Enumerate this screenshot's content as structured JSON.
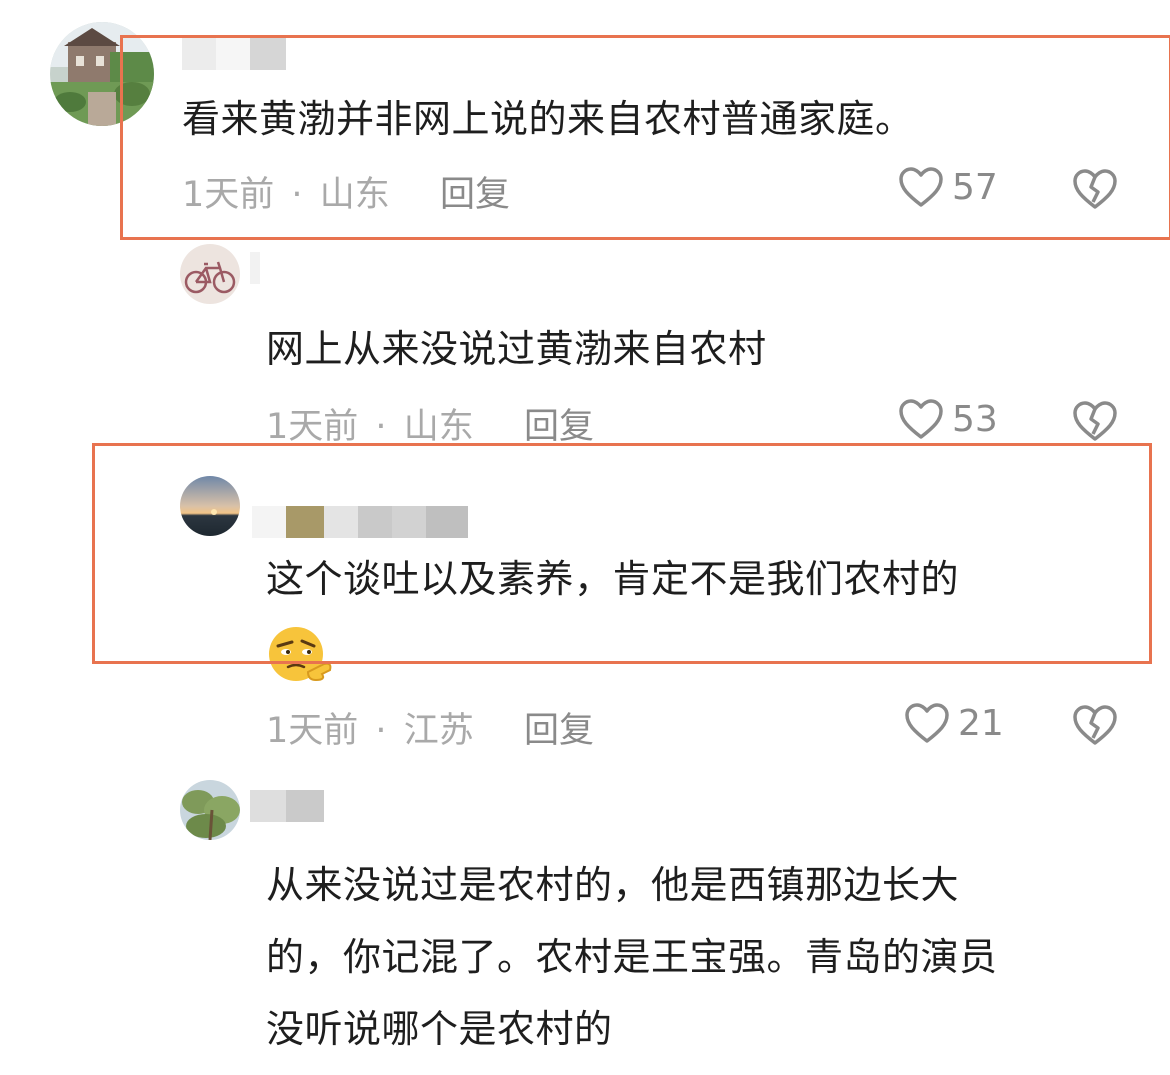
{
  "colors": {
    "highlight": "#e8734f",
    "meta_text": "#a9a9a9",
    "action_text": "#8a8a8a"
  },
  "comments": [
    {
      "text": "看来黄渤并非网上说的来自农村普通家庭。",
      "time": "1天前",
      "location": "山东",
      "reply_label": "回复",
      "likes": "57",
      "avatar": "house-photo",
      "highlighted": true
    },
    {
      "text": "网上从来没说过黄渤来自农村",
      "time": "1天前",
      "location": "山东",
      "reply_label": "回复",
      "likes": "53",
      "avatar": "bicycle-photo",
      "highlighted": false
    },
    {
      "text": "这个谈吐以及素养，肯定不是我们农村的",
      "emoji": "thinking-emoji",
      "time": "1天前",
      "location": "江苏",
      "reply_label": "回复",
      "likes": "21",
      "avatar": "sunset-photo",
      "highlighted": true
    },
    {
      "lines": [
        "从来没说过是农村的，他是西镇那边长大",
        "的，你记混了。农村是王宝强。青岛的演员",
        "没听说哪个是农村的"
      ],
      "avatar": "tree-photo",
      "highlighted": false
    }
  ],
  "separator": "·",
  "icons": {
    "like": "heart-outline-icon",
    "dislike": "broken-heart-icon"
  }
}
